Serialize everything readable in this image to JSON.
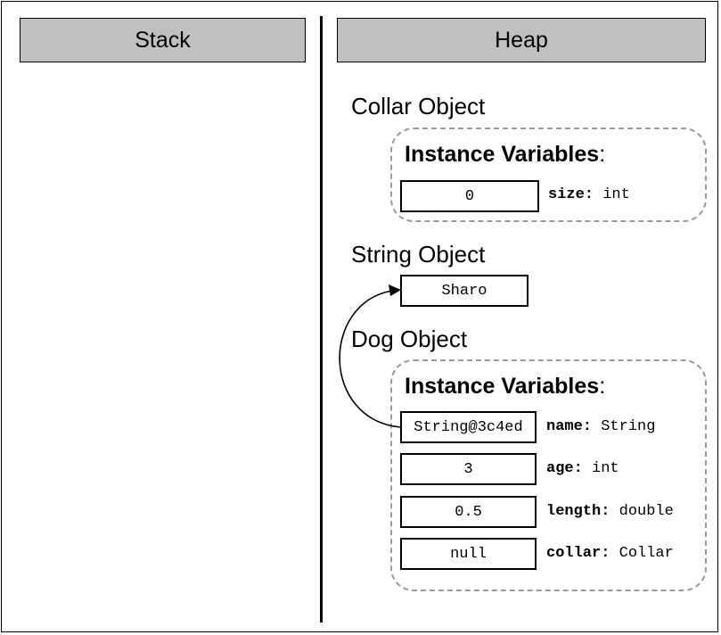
{
  "stack": {
    "title": "Stack"
  },
  "heap": {
    "title": "Heap",
    "collar": {
      "title": "Collar Object",
      "iv_title": "Instance Variables",
      "iv_colon": ":",
      "fields": [
        {
          "value": "0",
          "name": "size:",
          "type": "int"
        }
      ]
    },
    "string": {
      "title": "String Object",
      "value": "Sharo"
    },
    "dog": {
      "title": "Dog Object",
      "iv_title": "Instance Variables",
      "iv_colon": ":",
      "fields": [
        {
          "value": "String@3c4ed",
          "name": "name:",
          "type": "String"
        },
        {
          "value": "3",
          "name": "age:",
          "type": "int"
        },
        {
          "value": "0.5",
          "name": "length:",
          "type": "double"
        },
        {
          "value": "null",
          "name": "collar:",
          "type": "Collar"
        }
      ]
    }
  }
}
